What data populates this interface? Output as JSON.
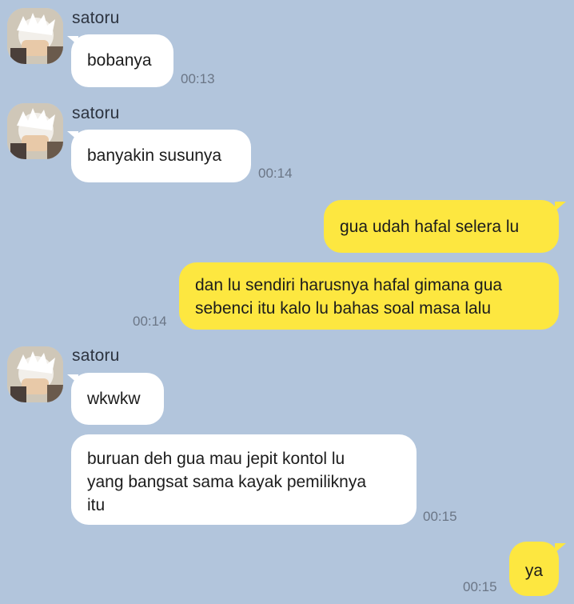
{
  "chat": {
    "messages": [
      {
        "sender": "satoru",
        "text": "bobanya",
        "time": "00:13"
      },
      {
        "sender": "satoru",
        "text": "banyakin susunya",
        "time": "00:14"
      },
      {
        "sender": "me",
        "text": "gua udah hafal selera lu"
      },
      {
        "sender": "me",
        "text": "dan lu sendiri harusnya hafal gimana gua\nsebenci itu kalo lu bahas soal masa lalu",
        "time": "00:14"
      },
      {
        "sender": "satoru",
        "text": "wkwkw"
      },
      {
        "sender": "satoru",
        "text": "buruan deh gua mau jepit kontol lu\nyang bangsat sama kayak pemiliknya\nitu",
        "time": "00:15"
      },
      {
        "sender": "me",
        "text": "ya",
        "time": "00:15"
      }
    ]
  },
  "colors": {
    "background": "#b2c5dc",
    "incoming_bubble": "#ffffff",
    "outgoing_bubble": "#fde740",
    "timestamp": "#6b7686"
  },
  "icons": {
    "avatar": "contact-avatar-icon"
  }
}
